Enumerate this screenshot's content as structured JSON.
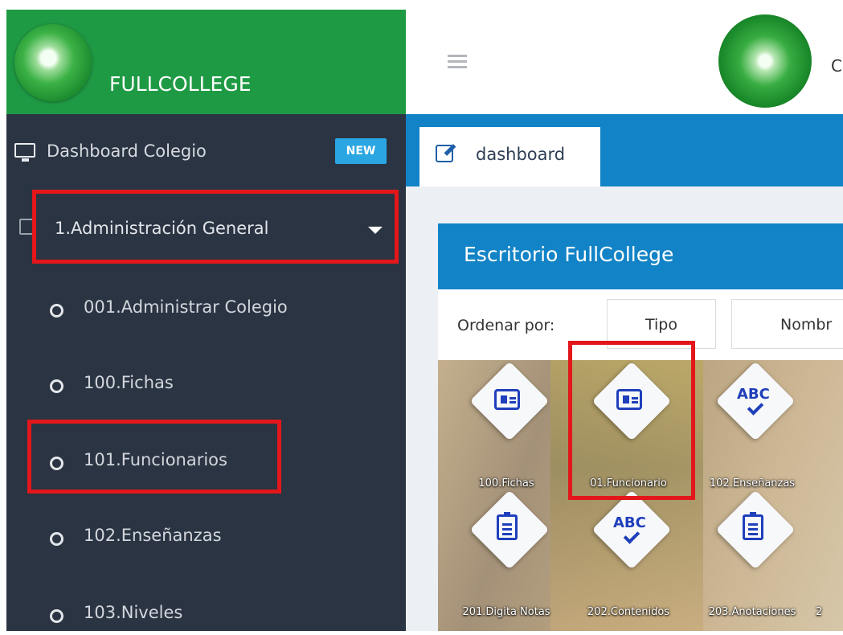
{
  "brand": {
    "name": "FULLCOLLEGE"
  },
  "header": {
    "user_initial": "C"
  },
  "sidebar": {
    "dashboard": {
      "label": "Dashboard Colegio",
      "badge": "NEW"
    },
    "section": {
      "label": "1.Administración General"
    },
    "items": [
      {
        "label": "001.Administrar Colegio"
      },
      {
        "label": "100.Fichas"
      },
      {
        "label": "101.Funcionarios"
      },
      {
        "label": "102.Enseñanzas"
      },
      {
        "label": "103.Niveles"
      }
    ]
  },
  "tabs": [
    {
      "label": "dashboard"
    }
  ],
  "panel": {
    "title": "Escritorio FullCollege",
    "sort_label": "Ordenar por:",
    "sort_options": [
      "Tipo",
      "Nombr"
    ]
  },
  "tiles": [
    {
      "label": "100.Fichas",
      "icon": "id-card-icon"
    },
    {
      "label": "01.Funcionario",
      "icon": "id-card-icon"
    },
    {
      "label": "102.Enseñanzas",
      "icon": "abc-check-icon"
    },
    {
      "label": "201.Digita Notas",
      "icon": "clipboard-icon"
    },
    {
      "label": "202.Contenidos",
      "icon": "abc-check-icon"
    },
    {
      "label": "203.Anotaciones",
      "icon": "clipboard-icon"
    },
    {
      "label": "2",
      "icon": ""
    }
  ],
  "colors": {
    "brand_green": "#1f9a44",
    "sidebar_bg": "#2b3442",
    "accent_blue": "#1283c6",
    "badge_blue": "#2aa7e3",
    "highlight_red": "#e3171b"
  }
}
